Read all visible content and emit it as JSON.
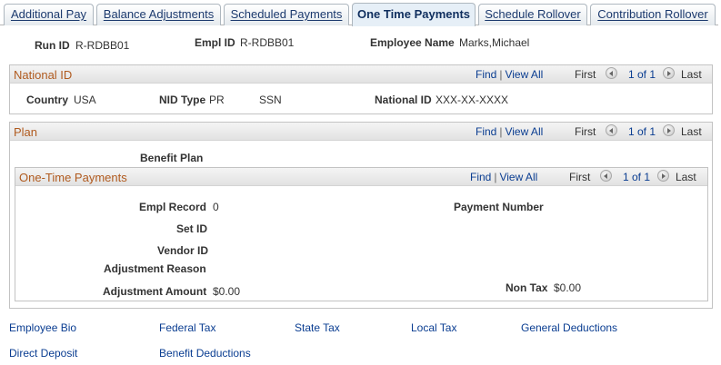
{
  "tabs": [
    {
      "label": "Additional Pay",
      "active": false
    },
    {
      "label": "Balance Adjustments",
      "active": false
    },
    {
      "label": "Scheduled Payments",
      "active": false
    },
    {
      "label": "One Time Payments",
      "active": true
    },
    {
      "label": "Schedule Rollover",
      "active": false
    },
    {
      "label": "Contribution Rollover",
      "active": false
    }
  ],
  "header": {
    "run_id_label": "Run ID",
    "run_id_value": "R-RDBB01",
    "empl_id_label": "Empl ID",
    "empl_id_value": "R-RDBB01",
    "employee_name_label": "Employee Name",
    "employee_name_value": "Marks,Michael"
  },
  "nav": {
    "find": "Find",
    "sep": "|",
    "view_all": "View All",
    "first": "First",
    "count": "1 of 1",
    "last": "Last"
  },
  "national_id": {
    "title": "National ID",
    "country_label": "Country",
    "country_value": "USA",
    "nid_type_label": "NID Type",
    "nid_type_value": "PR",
    "nid_type_desc": "SSN",
    "national_id_label": "National ID",
    "national_id_value": "XXX-XX-XXXX"
  },
  "plan": {
    "title": "Plan",
    "benefit_plan_label": "Benefit Plan"
  },
  "one_time_payments": {
    "title": "One-Time Payments",
    "empl_record_label": "Empl Record",
    "empl_record_value": "0",
    "payment_number_label": "Payment Number",
    "set_id_label": "Set ID",
    "vendor_id_label": "Vendor ID",
    "adjustment_reason_label": "Adjustment Reason",
    "adjustment_amount_label": "Adjustment Amount",
    "adjustment_amount_value": "$0.00",
    "non_tax_label": "Non Tax",
    "non_tax_value": "$0.00"
  },
  "bottom_links": [
    "Employee Bio",
    "Federal Tax",
    "State Tax",
    "Local Tax",
    "General Deductions",
    "Direct Deposit",
    "Benefit Deductions"
  ]
}
